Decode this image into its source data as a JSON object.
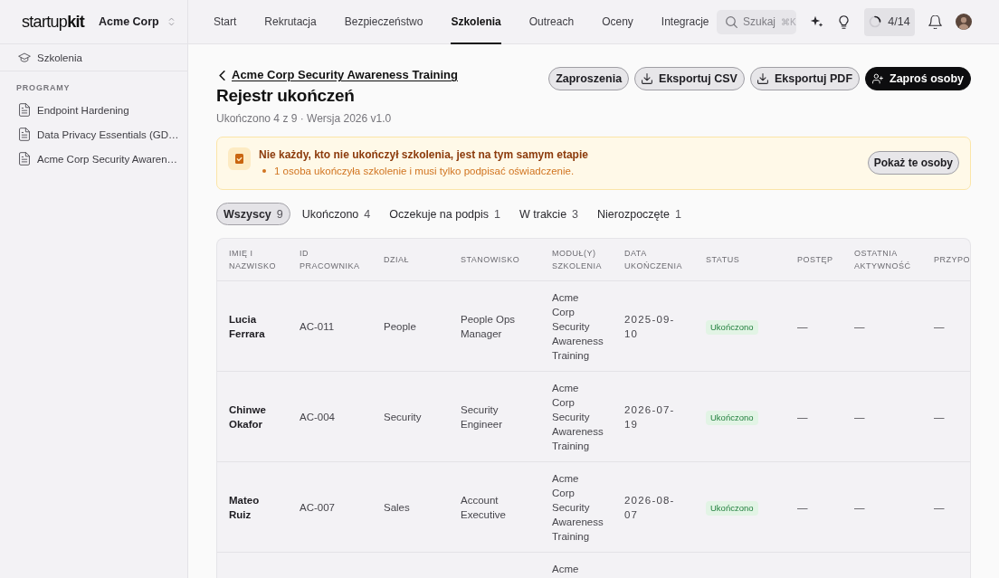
{
  "topbar": {
    "logo": "startup**kit**",
    "workspace": "Acme Corp",
    "nav": [
      {
        "label": "Start",
        "selected": false
      },
      {
        "label": "Rekrutacja",
        "selected": false
      },
      {
        "label": "Bezpieczeństwo",
        "selected": false
      },
      {
        "label": "Szkolenia",
        "selected": true
      },
      {
        "label": "Outreach",
        "selected": false
      },
      {
        "label": "Oceny",
        "selected": false
      },
      {
        "label": "Integracje",
        "selected": false
      }
    ],
    "search": {
      "placeholder": "Szukaj",
      "shortcut": "⌘K"
    },
    "progress": {
      "label": "4/14"
    }
  },
  "sidebar": {
    "section_link": "Szkolenia",
    "group_label": "PROGRAMY",
    "programs": [
      {
        "label": "Endpoint Hardening",
        "selected": false
      },
      {
        "label": "Data Privacy Essentials (GD…",
        "selected": false
      },
      {
        "label": "Acme Corp Security Awaren…",
        "selected": false
      }
    ]
  },
  "page_header": {
    "back_link": "Acme Corp Security Awareness Training",
    "title": "Rejestr ukończeń",
    "subtitle": "Ukończono 4 z 9 · Wersja 2026 v1.0",
    "actions": [
      {
        "label": "Zaproszenia",
        "kind": "plain"
      },
      {
        "label": "Eksportuj CSV",
        "kind": "export"
      },
      {
        "label": "Eksportuj PDF",
        "kind": "export"
      },
      {
        "label": "Zaproś osoby",
        "kind": "invite"
      }
    ]
  },
  "alert": {
    "title": "Nie każdy, kto nie ukończył szkolenia, jest na tym samym etapie",
    "items": [
      "1 osoba ukończyła szkolenie i musi tylko podpisać oświadczenie."
    ],
    "action": "Pokaż te osoby"
  },
  "filters": [
    {
      "label": "Wszyscy",
      "count": "9",
      "selected": true
    },
    {
      "label": "Ukończono",
      "count": "4",
      "selected": false
    },
    {
      "label": "Oczekuje na podpis",
      "count": "1",
      "selected": false
    },
    {
      "label": "W trakcie",
      "count": "3",
      "selected": false
    },
    {
      "label": "Nierozpoczęte",
      "count": "1",
      "selected": false
    }
  ],
  "table": {
    "columns": [
      "IMIĘ I NAZWISKO",
      "ID PRACOWNIKA",
      "DZIAŁ",
      "STANOWISKO",
      "MODUŁ(Y) SZKOLENIA",
      "DATA UKOŃCZENIA",
      "STATUS",
      "POSTĘP",
      "OSTATNIA AKTYWNOŚĆ",
      "PRZYPO"
    ],
    "rows": [
      {
        "name": "Lucia Ferrara",
        "employee_id": "AC-011",
        "department": "People",
        "position": "People Ops Manager",
        "modules": "Acme Corp Security Awareness Training",
        "completed_on": "2025-09-10",
        "status": "Ukończono",
        "progress": "—",
        "last_activity": "—",
        "column_10": "—"
      },
      {
        "name": "Chinwe Okafor",
        "employee_id": "AC-004",
        "department": "Security",
        "position": "Security Engineer",
        "modules": "Acme Corp Security Awareness Training",
        "completed_on": "2026-07-19",
        "status": "Ukończono",
        "progress": "—",
        "last_activity": "—",
        "column_10": "—"
      },
      {
        "name": "Mateo Ruiz",
        "employee_id": "AC-007",
        "department": "Sales",
        "position": "Account Executive",
        "modules": "Acme Corp Security Awareness Training",
        "completed_on": "2026-08-07",
        "status": "Ukończono",
        "progress": "—",
        "last_activity": "—",
        "column_10": "—"
      },
      {
        "modules": "Acme"
      }
    ]
  }
}
